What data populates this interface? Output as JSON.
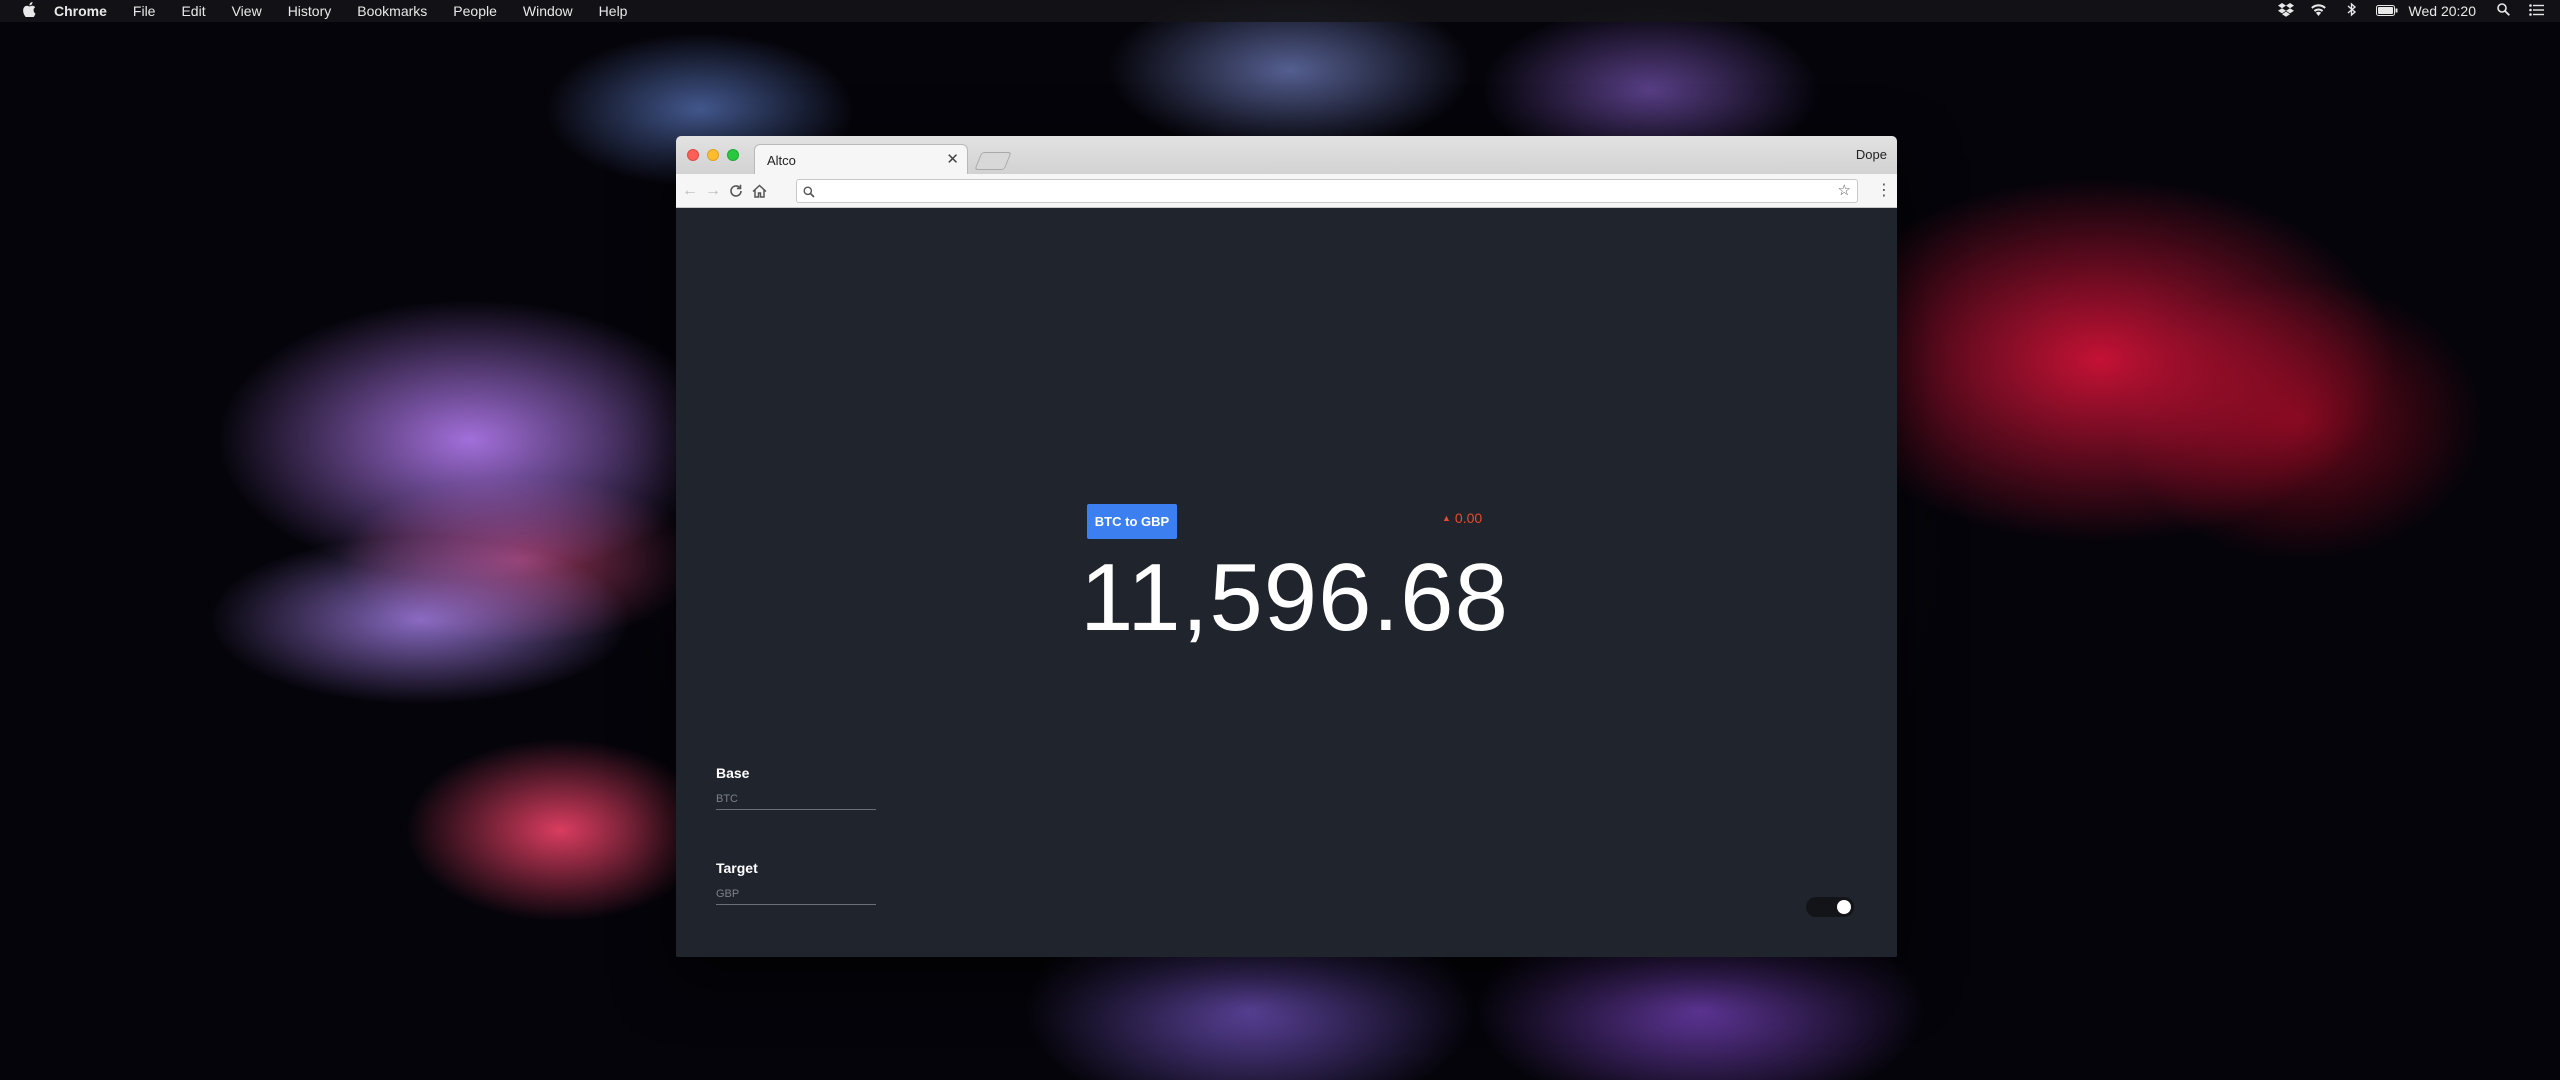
{
  "menubar": {
    "app_name": "Chrome",
    "items": [
      "File",
      "Edit",
      "View",
      "History",
      "Bookmarks",
      "People",
      "Window",
      "Help"
    ],
    "clock": "Wed 20:20",
    "status_icons": [
      "dropbox-icon",
      "wifi-icon",
      "bluetooth-icon",
      "battery-icon",
      "spotlight-search-icon",
      "notification-center-icon"
    ]
  },
  "browser": {
    "tab_title": "Altco",
    "profile_name": "Dope",
    "address": "",
    "page": {
      "pair_button_label": "BTC to GBP",
      "change_value": "0.00",
      "rate": "11,596.68",
      "base": {
        "label": "Base",
        "placeholder": "BTC"
      },
      "target": {
        "label": "Target",
        "placeholder": "GBP"
      },
      "toggle_on": true
    }
  },
  "colors": {
    "page_background": "#20242d",
    "accent": "#3c7ff0",
    "change": "#e54b2f"
  }
}
